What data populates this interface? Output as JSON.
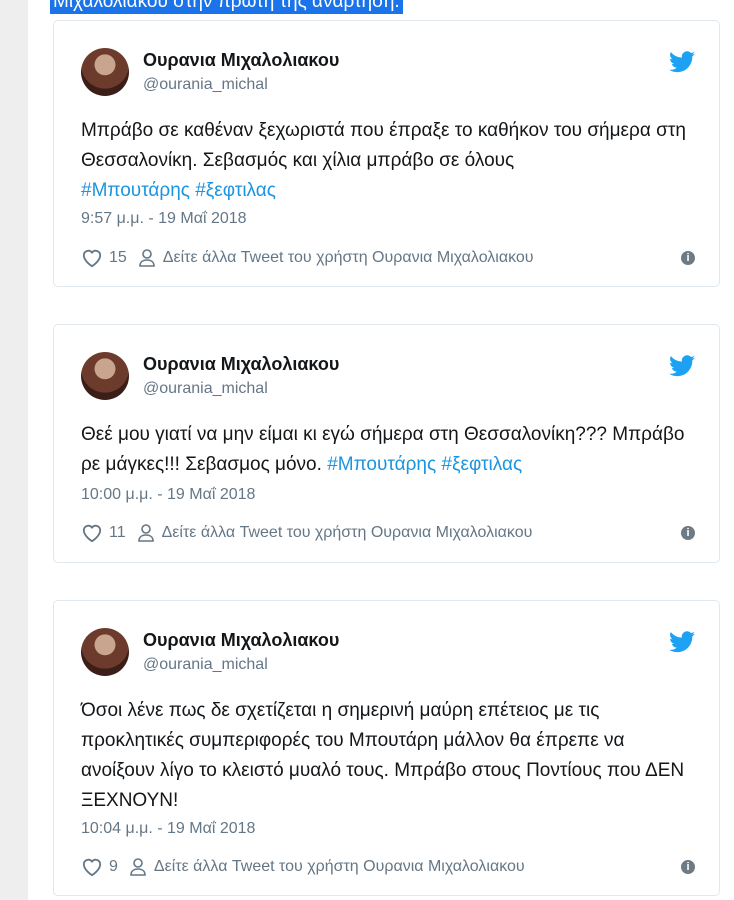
{
  "header_highlight": "Μιχαλολιάκου στην πρώτη της ανάρτηση.",
  "account": {
    "name": "Ουρανια Μιχαλολιακου",
    "handle": "@ourania_michal"
  },
  "more_tweets_label": "Δείτε άλλα Tweet του χρήστη Ουρανια Μιχαλολιακου",
  "colors": {
    "hashtag": "#1b95e0",
    "twitter_bird": "#1da1f2",
    "highlight": "#1a73e8"
  },
  "tweets": [
    {
      "text_plain": "Μπράβο σε καθέναν ξεχωριστά που έπραξε το καθήκον του σήμερα στη Θεσσαλονίκη. Σεβασμός και χίλια μπράβο σε όλους",
      "hashtags": [
        "#Μπουτάρης",
        "#ξεφτιλας"
      ],
      "timestamp": "9:57 μ.μ. - 19 Μαΐ 2018",
      "likes": "15"
    },
    {
      "text_plain": "Θεέ μου γιατί να μην είμαι κι εγώ σήμερα στη Θεσσαλονίκη??? Μπράβο ρε μάγκες!!! Σεβασμος μόνο.",
      "hashtags": [
        "#Μπουτάρης",
        "#ξεφτιλας"
      ],
      "timestamp": "10:00 μ.μ. - 19 Μαΐ 2018",
      "likes": "11"
    },
    {
      "text_plain": "Όσοι λένε πως δε σχετίζεται η σημερινή μαύρη επέτειος με τις προκλητικές συμπεριφορές του Μπουτάρη μάλλον θα έπρεπε να ανοίξουν λίγο το κλειστό μυαλό τους. Μπράβο στους Ποντίους που ΔΕΝ ΞΕΧΝΟΥΝ!",
      "hashtags": [],
      "timestamp": "10:04 μ.μ. - 19 Μαΐ 2018",
      "likes": "9"
    }
  ]
}
